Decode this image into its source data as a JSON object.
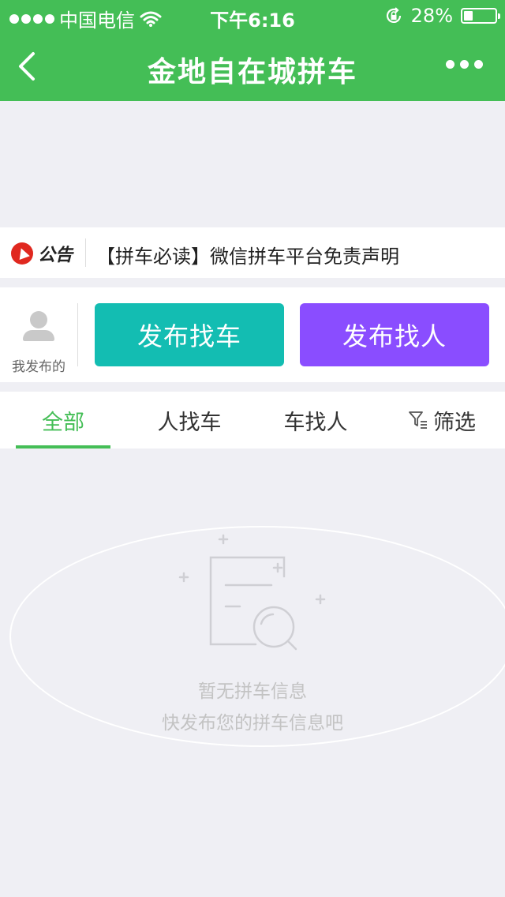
{
  "status_bar": {
    "carrier": "中国电信",
    "time": "下午6:16",
    "battery_percent": "28%",
    "battery_level": 0.28,
    "signal_bars": 4,
    "icons": [
      "signal-dots-icon",
      "wifi-icon",
      "rotation-lock-icon",
      "battery-icon"
    ]
  },
  "nav": {
    "title": "金地自在城拼车",
    "back_icon": "chevron-left-icon",
    "more_icon": "more-dots-icon"
  },
  "notice": {
    "badge_text": "公告",
    "text": "【拼车必读】微信拼车平台免责声明"
  },
  "publish": {
    "my_posts_label": "我发布的",
    "find_car_label": "发布找车",
    "find_person_label": "发布找人",
    "find_car_color": "#13bdb2",
    "find_person_color": "#8a4dff"
  },
  "tabs": [
    {
      "label": "全部",
      "active": true
    },
    {
      "label": "人找车",
      "active": false
    },
    {
      "label": "车找人",
      "active": false
    },
    {
      "label": "筛选",
      "active": false,
      "icon": "filter-icon"
    }
  ],
  "empty_state": {
    "title": "暂无拼车信息",
    "subtitle": "快发布您的拼车信息吧",
    "icon": "empty-search-document-icon"
  },
  "colors": {
    "brand_green": "#44be56",
    "background": "#efeff4"
  }
}
